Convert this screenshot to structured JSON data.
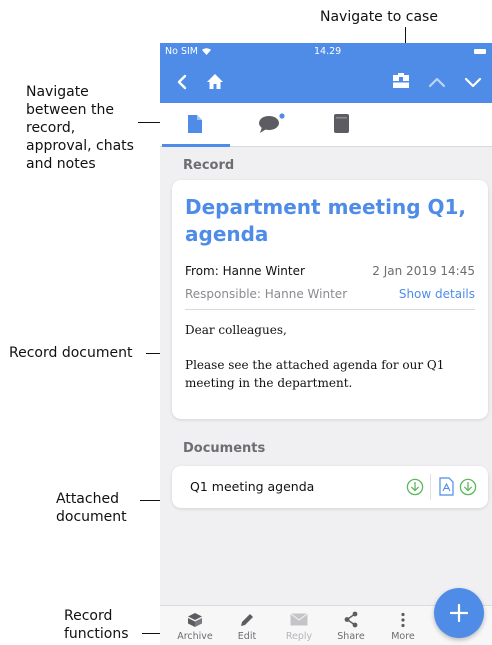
{
  "annotations": {
    "navigate_to_case": "Navigate to case",
    "navigate_tabs": [
      "Navigate",
      "between the",
      "record,",
      "approval, chats",
      "and notes"
    ],
    "record_document": "Record document",
    "attached_document": [
      "Attached",
      "document"
    ],
    "record_functions": [
      "Record",
      "functions"
    ]
  },
  "status_bar": {
    "carrier": "No SIM",
    "time": "14.29"
  },
  "section_record": "Record",
  "record": {
    "title_line1": "Department meeting Q1,",
    "title_line2": "agenda",
    "from": "From: Hanne Winter",
    "date": "2 Jan 2019 14:45",
    "responsible": "Responsible: Hanne Winter",
    "show_details": "Show details",
    "greeting": "Dear colleagues,",
    "body_line1": "Please see the attached agenda for our Q1",
    "body_line2": "meeting in the department."
  },
  "section_documents": "Documents",
  "document": {
    "name": "Q1 meeting agenda"
  },
  "toolbar": {
    "archive": "Archive",
    "edit": "Edit",
    "reply": "Reply",
    "share": "Share",
    "more": "More"
  },
  "colors": {
    "accent": "#4f8ce8",
    "download": "#5cb85c",
    "pdf": "#4f8ce8"
  },
  "icons": [
    "back-chevron-icon",
    "home-icon",
    "case-icon",
    "up-chevron-icon",
    "down-chevron-icon",
    "document-icon",
    "chat-icon",
    "notebook-icon",
    "download-icon",
    "pdf-icon",
    "archive-icon",
    "pencil-icon",
    "mail-icon",
    "share-icon",
    "more-icon",
    "plus-icon"
  ]
}
